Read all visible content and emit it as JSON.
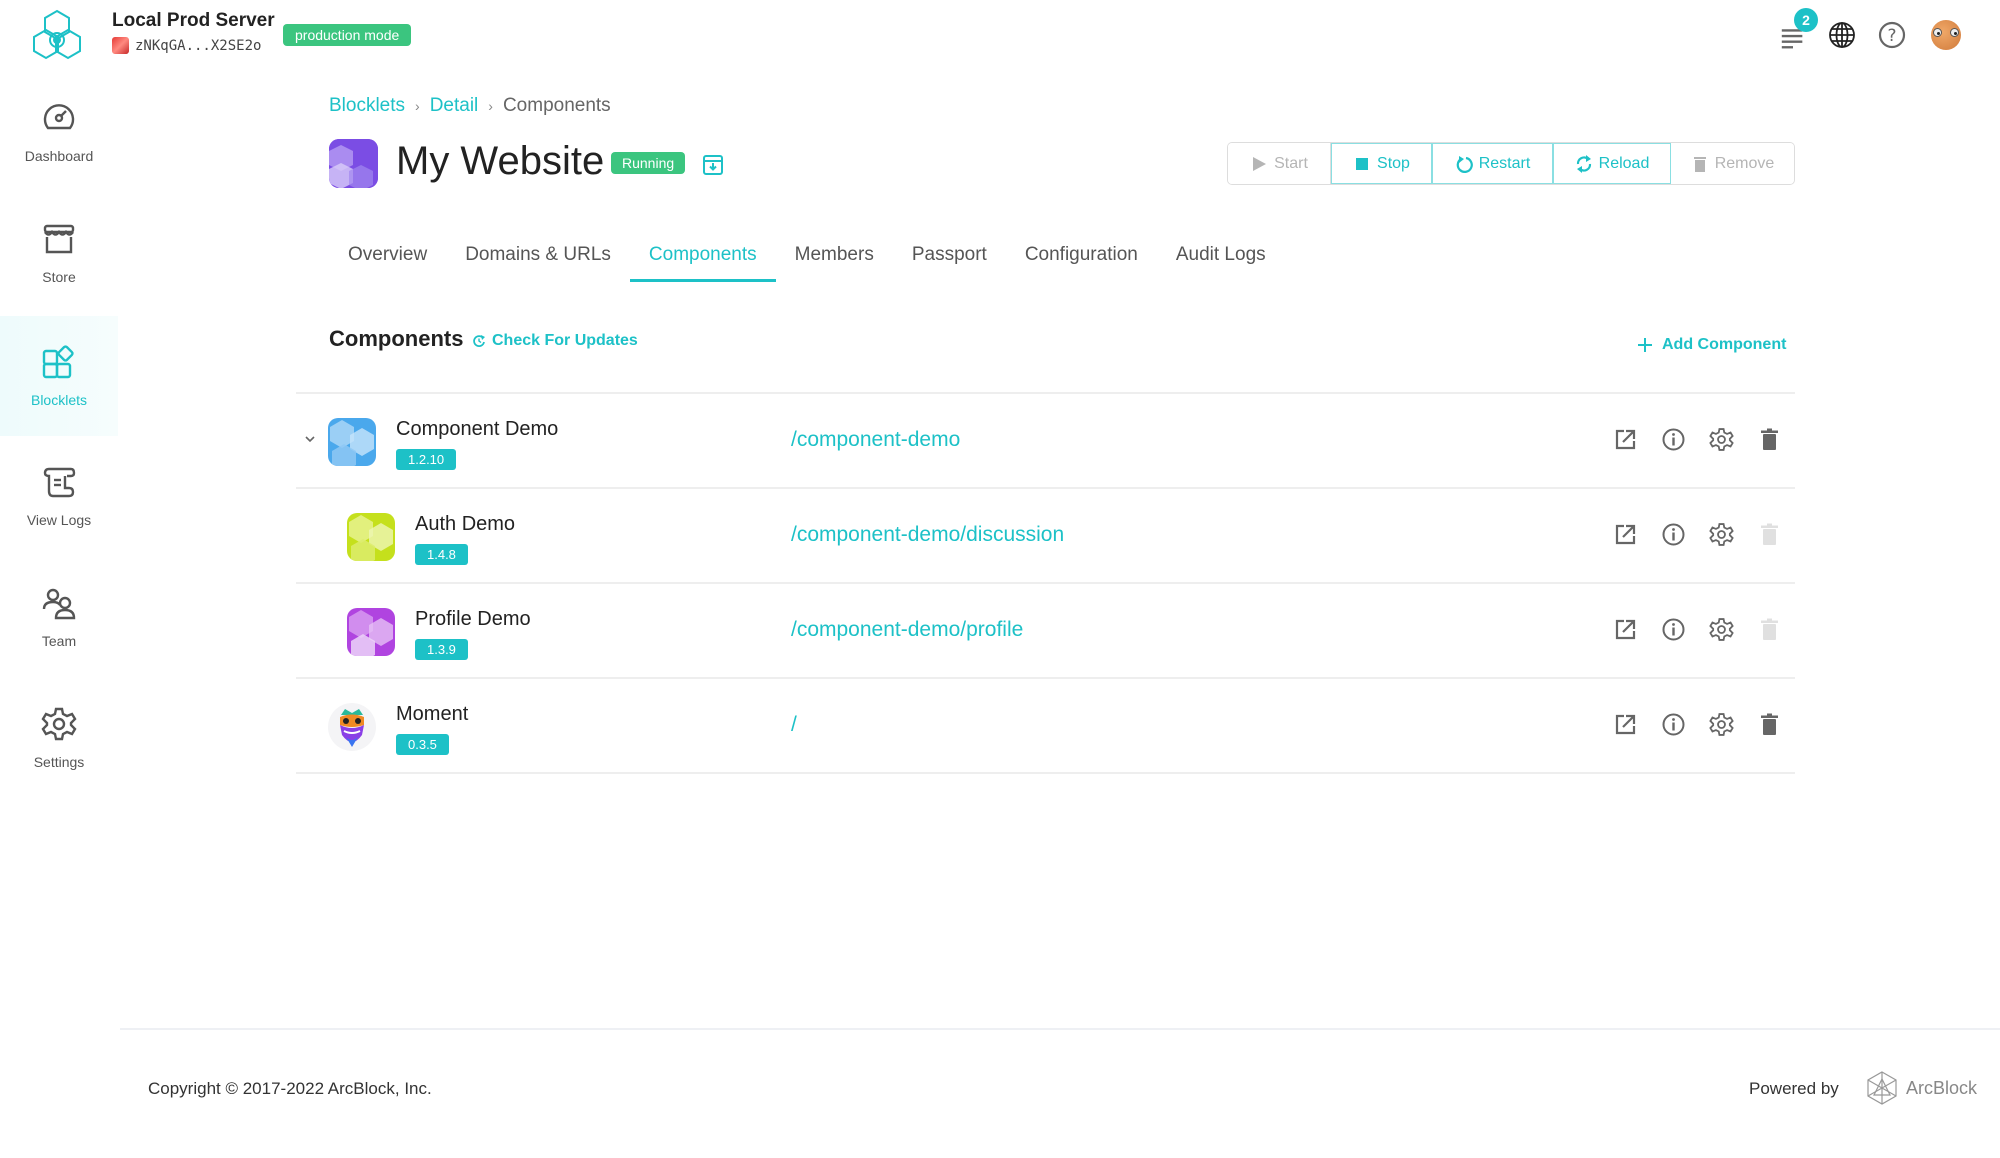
{
  "header": {
    "server_title": "Local Prod Server",
    "server_did": "zNKqGA...X2SE2o",
    "mode_badge": "production mode",
    "notification_count": "2",
    "icons": [
      "notification-list-icon",
      "globe-icon",
      "help-icon",
      "user-avatar"
    ]
  },
  "sidebar": {
    "items": [
      {
        "label": "Dashboard",
        "icon": "dashboard-gauge-icon",
        "active": false
      },
      {
        "label": "Store",
        "icon": "store-icon",
        "active": false
      },
      {
        "label": "Blocklets",
        "icon": "blocklets-icon",
        "active": true
      },
      {
        "label": "View Logs",
        "icon": "logs-scroll-icon",
        "active": false
      },
      {
        "label": "Team",
        "icon": "team-icon",
        "active": false
      },
      {
        "label": "Settings",
        "icon": "settings-gear-icon",
        "active": false
      }
    ]
  },
  "breadcrumb": {
    "items": [
      "Blocklets",
      "Detail",
      "Components"
    ]
  },
  "blocklet": {
    "title": "My Website",
    "status": "Running"
  },
  "actions": {
    "start": "Start",
    "stop": "Stop",
    "restart": "Restart",
    "reload": "Reload",
    "remove": "Remove"
  },
  "tabs": [
    {
      "label": "Overview",
      "active": false
    },
    {
      "label": "Domains & URLs",
      "active": false
    },
    {
      "label": "Components",
      "active": true
    },
    {
      "label": "Members",
      "active": false
    },
    {
      "label": "Passport",
      "active": false
    },
    {
      "label": "Configuration",
      "active": false
    },
    {
      "label": "Audit Logs",
      "active": false
    }
  ],
  "components": {
    "title": "Components",
    "check_updates": "Check For Updates",
    "add_component": "Add Component",
    "rows": [
      {
        "name": "Component Demo",
        "version": "1.2.10",
        "mount": "/component-demo",
        "expandable": true,
        "child": false,
        "delete_enabled": true
      },
      {
        "name": "Auth Demo",
        "version": "1.4.8",
        "mount": "/component-demo/discussion",
        "expandable": false,
        "child": true,
        "delete_enabled": false
      },
      {
        "name": "Profile Demo",
        "version": "1.3.9",
        "mount": "/component-demo/profile",
        "expandable": false,
        "child": true,
        "delete_enabled": false
      },
      {
        "name": "Moment",
        "version": "0.3.5",
        "mount": "/",
        "expandable": false,
        "child": false,
        "delete_enabled": true
      }
    ]
  },
  "footer": {
    "copyright": "Copyright © 2017-2022  ArcBlock, Inc.",
    "powered_by": "Powered by",
    "brand": "ArcBlock"
  },
  "colors": {
    "accent": "#1dc1c7",
    "success": "#3bc57f",
    "text": "#222222",
    "muted": "#b5b5b5"
  }
}
